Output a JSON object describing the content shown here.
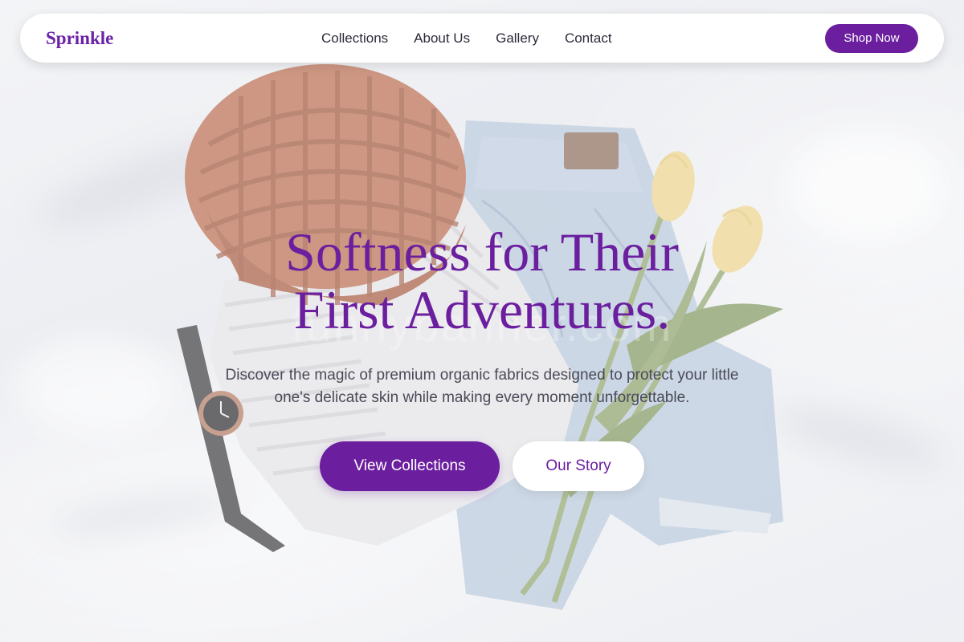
{
  "brand": {
    "name": "Sprinkle"
  },
  "nav": {
    "links": [
      "Collections",
      "About Us",
      "Gallery",
      "Contact"
    ],
    "cta_label": "Shop Now"
  },
  "hero": {
    "title_line1": "Softness for Their",
    "title_line2": "First Adventures.",
    "subtitle": "Discover the magic of premium organic fabrics designed to protect your little one's delicate skin while making every moment unforgettable.",
    "primary_cta": "View Collections",
    "secondary_cta": "Our Story",
    "watermark": "funnybanner.com"
  },
  "colors": {
    "accent": "#6b1f9e",
    "text_dark": "#2b2b3a",
    "text_muted": "#4a4a58",
    "background": "#ecedf1"
  },
  "background_image": {
    "subject": "flat lay of knit beanie, sweater, jeans, wristwatch and tulips on white bedsheet",
    "icon_names": [
      "beanie-illustration",
      "sweater-illustration",
      "jeans-illustration",
      "watch-illustration",
      "tulip-illustration"
    ]
  }
}
